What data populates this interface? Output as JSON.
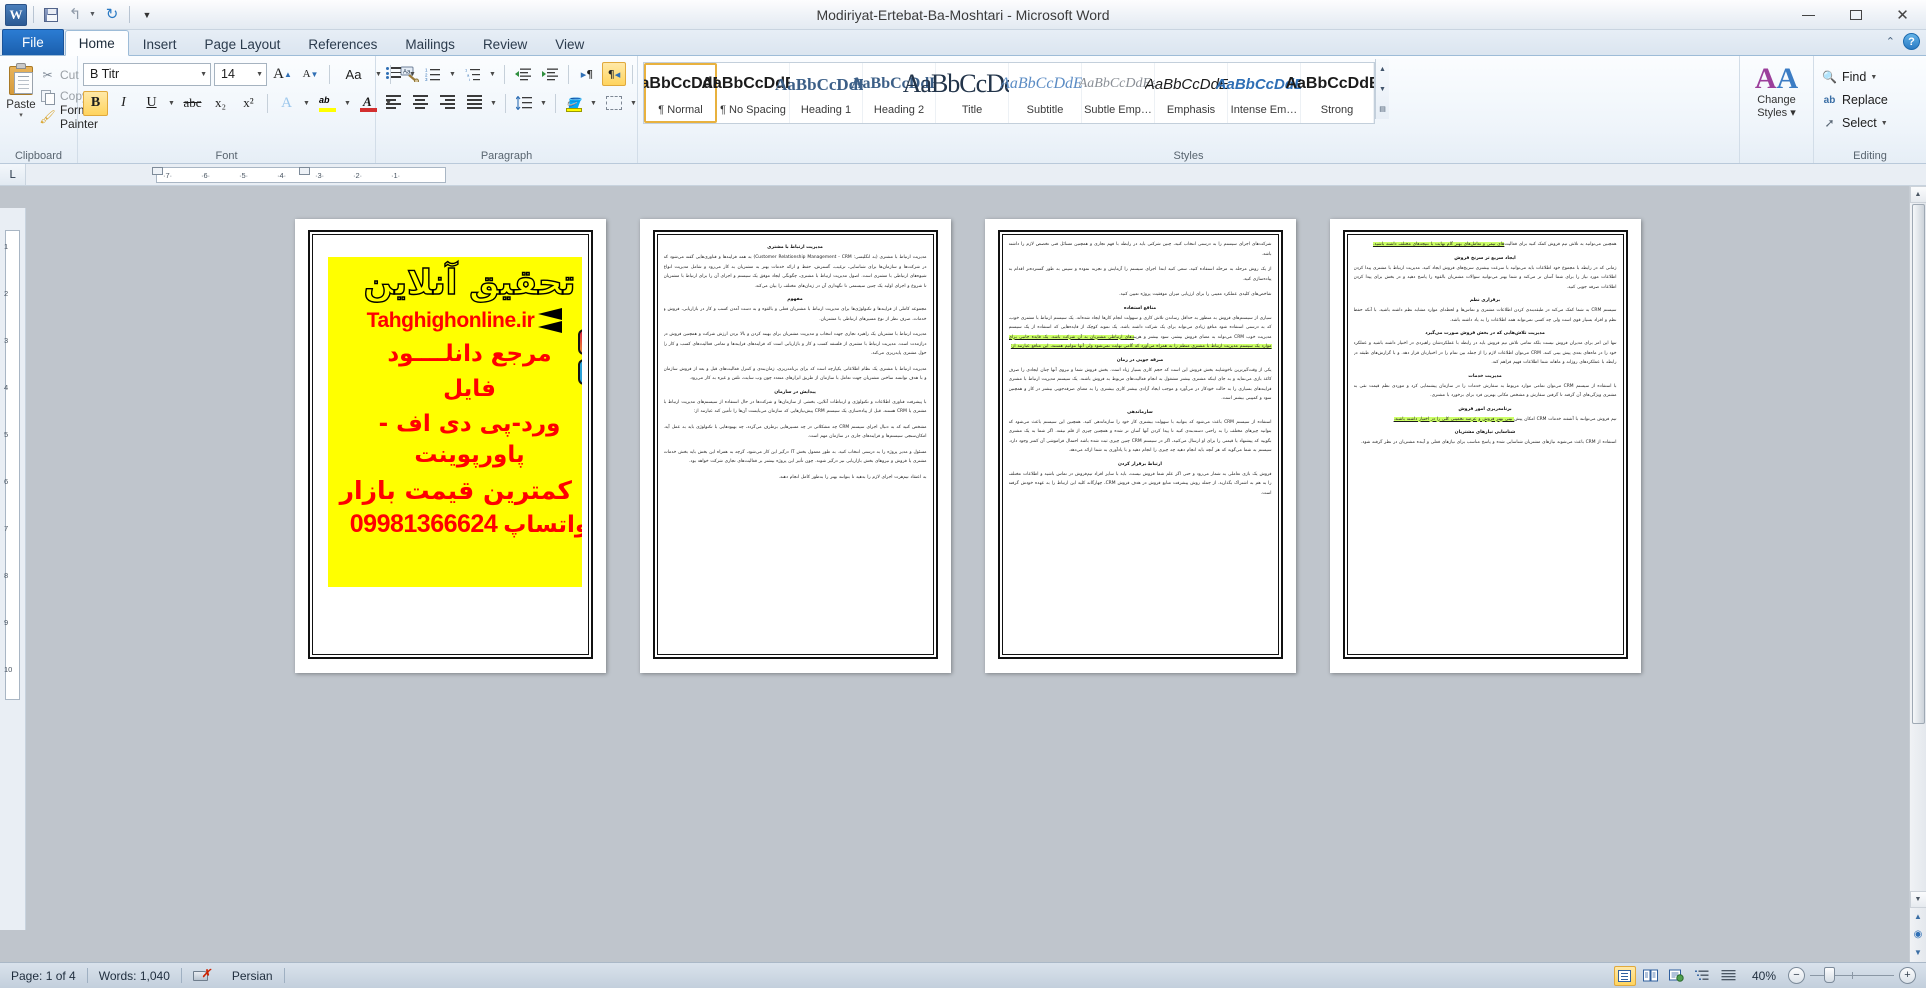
{
  "window": {
    "title": "Modiriyat-Ertebat-Ba-Moshtari  -  Microsoft Word",
    "minimize": "—",
    "maximize": "□",
    "close": "✕"
  },
  "qat": {
    "app_icon": "word-logo",
    "save": "save-icon",
    "undo": "↰",
    "undo_caret": "▾",
    "redo": "↻",
    "customize": "▾"
  },
  "tabs": [
    {
      "label": "File",
      "active": false,
      "file": true
    },
    {
      "label": "Home",
      "active": true,
      "file": false
    },
    {
      "label": "Insert",
      "active": false,
      "file": false
    },
    {
      "label": "Page Layout",
      "active": false,
      "file": false
    },
    {
      "label": "References",
      "active": false,
      "file": false
    },
    {
      "label": "Mailings",
      "active": false,
      "file": false
    },
    {
      "label": "Review",
      "active": false,
      "file": false
    },
    {
      "label": "View",
      "active": false,
      "file": false
    }
  ],
  "tabstrip_right": {
    "minimize_ribbon": "⌃",
    "help": "?"
  },
  "ribbon": {
    "clipboard": {
      "group_label": "Clipboard",
      "paste": "Paste",
      "paste_caret": "▾",
      "cut": "Cut",
      "copy": "Copy",
      "format_painter": "Format Painter",
      "launcher": "◢"
    },
    "font": {
      "group_label": "Font",
      "font_name": "B Titr",
      "font_size": "14",
      "grow_font": "A",
      "shrink_font": "A",
      "change_case": "Aa",
      "clear_formatting": "Ab",
      "bold": "B",
      "italic": "I",
      "underline": "U",
      "strikethrough": "abc",
      "subscript": "x₂",
      "superscript": "x²",
      "text_effects": "A",
      "highlight": "ab",
      "font_color": "A",
      "caret": "▾",
      "launcher": "◢"
    },
    "paragraph": {
      "group_label": "Paragraph",
      "bullets": "bullets-icon",
      "numbering": "numbering-icon",
      "multilevel": "multilevel-list-icon",
      "decrease_indent": "decrease-indent-icon",
      "increase_indent": "increase-indent-icon",
      "ltr": "▸¶",
      "rtl": "¶◂",
      "sort": "A\\nZ↓",
      "show_marks": "¶",
      "align_left": "align-left-icon",
      "align_center": "align-center-icon",
      "align_right": "align-right-icon",
      "justify": "justify-icon",
      "line_spacing": "line-spacing-icon",
      "shading": "shading-icon",
      "borders": "borders-icon",
      "caret": "▾",
      "launcher": "◢"
    },
    "styles": {
      "group_label": "Styles",
      "items": [
        {
          "sample": "AaBbCcDdEe",
          "name": "¶ Normal",
          "cls": "sty-normal",
          "selected": true
        },
        {
          "sample": "AaBbCcDdEe",
          "name": "¶ No Spacing",
          "cls": "sty-nospace",
          "selected": false
        },
        {
          "sample": "AaBbCcDdEe",
          "name": "Heading 1",
          "cls": "sty-h1",
          "selected": false
        },
        {
          "sample": "AaBbCcDdEe",
          "name": "Heading 2",
          "cls": "sty-h2",
          "selected": false
        },
        {
          "sample": "AaBbCcDdEe",
          "name": "Title",
          "cls": "sty-title",
          "selected": false
        },
        {
          "sample": "AaBbCcDdEe",
          "name": "Subtitle",
          "cls": "sty-sub",
          "selected": false
        },
        {
          "sample": "AaBbCcDdEe",
          "name": "Subtle Emp…",
          "cls": "sty-subem",
          "selected": false
        },
        {
          "sample": "AaBbCcDdEe",
          "name": "Emphasis",
          "cls": "sty-em",
          "selected": false
        },
        {
          "sample": "AaBbCcDdEe",
          "name": "Intense Em…",
          "cls": "sty-intense",
          "selected": false
        },
        {
          "sample": "AaBbCcDdEe",
          "name": "Strong",
          "cls": "sty-strong",
          "selected": false
        }
      ],
      "scroll_up": "▲",
      "scroll_down": "▼",
      "more": "▤"
    },
    "change_styles": {
      "label_line1": "Change",
      "label_line2": "Styles",
      "caret": "▾"
    },
    "editing": {
      "group_label": "Editing",
      "find": "Find",
      "replace": "Replace",
      "select": "Select",
      "caret": "▾"
    }
  },
  "ruler": {
    "tab_selector": "L",
    "h_ticks": [
      "7",
      "6",
      "5",
      "4",
      "3",
      "2",
      "1"
    ],
    "v_ticks": [
      "1",
      "2",
      "3",
      "4",
      "5",
      "6",
      "7",
      "8",
      "9",
      "10"
    ]
  },
  "document": {
    "ad": {
      "line1": "تحقیق آنلاین",
      "url": "Tahghighonline.ir",
      "line2": "مرجع دانلــــود",
      "line3": "فایل",
      "line4": "ورد-پی دی اف - پاورپوینت",
      "line5": "با کمترین قیمت بازار",
      "phone": "09981366624",
      "whatsapp": "واتساپ",
      "badge_instagram": "instagram-icon",
      "badge_telegram": "telegram-icon"
    },
    "pages": [
      {
        "n": 1,
        "type": "image",
        "sections": []
      },
      {
        "n": 2,
        "type": "text",
        "sections": [
          {
            "heading": "مدیریت ارتباط با مشتری",
            "align": "center",
            "paras": [
              "مدیریت ارتباط با مشتری (به انگلیسی: Customer Relationship Management - CRM) به همه فرایندها و فناوری‌هایی گفته می‌شود که در شرکت‌ها و سازمان‌ها برای شناسایی، ترغیب، گسترش، حفظ و ارائه خدمات بهتر به مشتریان به کار می‌رود و شامل مدیریت انواع شیوه‌های ارتباطی با مشتری است. اصول مدیریت ارتباط با مشتری، چگونگی ایجاد موفق یک سیستم و اجرای آن را برای ارتباط با مشتریان تا شروع و اجرای اولیه یک چنین سیستمی تا نگهداری آن در زمان‌های مختلف را بیان می‌کند."
            ]
          },
          {
            "heading": "مفهوم",
            "align": "center",
            "paras": [
              "مجموعه کاملی از فرایندها و تکنولوژی‌ها برای مدیریت ارتباط با مشتریان فعلی و بالقوه و به دست آمدن کسب و کار در بازاریابی، فروش و خدمات، صرف نظر از نوع مسیرهای ارتباطی با مشتریان.",
              "مدیریت ارتباط با مشتریان یک راهبرد تجاری جهت انتخاب و مدیریت مشتریان برای بهینه کردن و بالا بردن ارزش شرکت و همچنین فروش در درازمدت است. مدیریت ارتباط با مشتری از فلسفه کسب و کار و بازاریابی است که فرایندهای فرایندها و تمامی فعالیت‌های کسب و کار را حول مشتری پایه‌ریزی می‌کند.",
              "مدیریت ارتباط با مشتری یک نظام اطلاعاتی یکپارچه است که برای برنامه‌ریزی، زمان‌بندی و کنترل فعالیت‌های قبل و بعد از فروش سازمان و با هدف توانمند ساختن مشتریان جهت تعامل با سازمان از طریق ابزارهای متعدد چون وب سایت، تلفن و غیره به کار می‌رود."
            ]
          },
          {
            "heading": "پیدایش در سازمان",
            "align": "center",
            "paras": [
              "با پیشرفت فناوری اطلاعات و تکنولوژی و ارتباطات آنلاین، بخشی از سازمان‌ها و شرکت‌ها در حال استفاده از سیستم‌های مدیریت ارتباط با مشتری یا CRM هستند. قبل از پیاده‌سازی یک سیستم CRM پیش‌نیازهایی که سازمان می‌بایست آن‌ها را تأمین کند عبارتند از:",
              "مشخص کنید که به دنبال اجرای سیستم CRM چه مشکلاتی در چه مسیرهایی برطرف می‌گردد، چه بهبودهایی با تکنولوژی باید به عمل آید. امکان‌سنجی سیستم‌ها و فرایندهای جاری در سازمان مهم است.",
              "مسئول و مدیر پروژه را به درستی انتخاب کنید. به طور معمول بخش IT درگیر این کار می‌شود، گرچه به همراه این بخش باید بخش خدمات مشتری یا فروش و نیروهای بخش بازاریابی نیز درگیر شوند. چون تأثیر این پروژه بیشتر بر فعالیت‌های تجاری شرکت خواهد بود.",
              "به اعتقاد تیم‌هرت اجرای لازم را بدهید تا بتوانند بهتر را به‌طور کامل انجام دهند."
            ]
          }
        ]
      },
      {
        "n": 3,
        "type": "text",
        "sections": [
          {
            "heading": "",
            "align": "right",
            "paras": [
              "شرکت‌های اجرای سیستم را به درستی انتخاب کنید، چنین شرکتی باید در رابطه با فهم تجاری و همچنین مسائل فنی تخصص لازم را داشته باشد.",
              "از یک روش مرحله به مرحله استفاده کنید، سعی کنید ابتدا اجرای سیستم را آزمایش و تجربه نموده و سپس به طور گسترده‌تر اقدام به پیاده‌سازی کنید.",
              "شاخص‌های کلیدی عملکرد معینی را برای ارزیابی میزان موفقیت پروژه تعیین کنید."
            ]
          },
          {
            "heading": "منافع استفاده",
            "align": "center",
            "paras": [
              "سیاری از سیستم‌های فروش به منظور به حداقل رساندن تلاش کاری و سهولت انجام کارها ایجاد شده‌اند. یک سیستم ارتباط با مشتری خوب، که به درستی استفاده شود منافع زیادی می‌تواند برای یک شرکت داشته باشد. یک نمونه کوچک از فایده‌هایی که استفاده از یک سیستم مدیریت خوب CRM می‌تواند به معنای فروش بیشتر، سود بیشتر و هزینه‌های ارتباطی مشتریان به آن شرکت باشد. یک فایده جانبی برای موارد یک سیستم مدیریت ارتباط با مشتری منظم را به همراه می‌آورد که گامی نهایت نمی‌شود ولی آنها نتوانیم هستند، این منافع عبارتند از:"
            ]
          },
          {
            "heading": "صرفه جویی در زمان",
            "align": "center",
            "paras": [
              "یکی از وقت‌گیرترین ناخوشایند بخش فروش این است که حجم کاری بسیار زیاد است. بخش فروش شما و نیروی آنها چنان ایجادی را صرف کاغذ بازی می‌نماید و به جای اینکه مشتری بیشتر مشغول به انجام فعالیت‌های مربوط به فروش باشند. یک سیستم مدیریت ارتباط با مشتری فرایندهای بسیاری را به حالت خودکار در می‌آورد و موجب ایجاد آزادی بیشتر کاری بیشتری را به معنای صرفه‌جویی بیشتر در کار و همچنین سود و کمپینی بیشتر است."
            ]
          },
          {
            "heading": "سازماندهی",
            "align": "center",
            "paras": [
              "استفاده از سیستم CRM باعث می‌شود که بتوانید با سهولت بیشتری کار خود را سازماندهی کنید. همچنین این سیستم باعث می‌شود که بتوانید چیزهای مختلف را به راحتی دسته‌بندی کنید تا پیدا کردن آنها آسان تر شده و همچنین چیزی از قلم نیفتد. اگر شما به یک مشتری بگویید که پیشنهاد یا قیمتی را برای او ارسال می‌کنید، اگر در سیستم CRM چنین چیزی ثبت شده باشد احتمال فراموشی آن کمتر وجود دارد. سیستم به شما می‌گوید که هر آنچه باید انجام دهید چه چیزی را انجام دهید و با یادآوری به شما ارائه می‌دهد."
            ]
          },
          {
            "heading": "ارتباط برقرار کردن",
            "align": "center",
            "paras": [
              "فروش یک بازی تعاملی به شمار می‌رود و حتی اگر علم شما فروش نیست، باید با سایر افراد تیم‌فروش در تماس باشید و اطلاعات مختلف را به هم به اشتراک بگذارید. از جمله روش پیشرفت منابع فروش در هدف فروش CRM، چهارگانه کلید این ارتباط را به عهده خودش گرفته است."
            ]
          }
        ]
      },
      {
        "n": 4,
        "type": "text",
        "sections": [
          {
            "heading": "",
            "align": "right",
            "paras": [
              "همچنین می‌توانید به تلاش تیم فروش کمک کنید برای فعالیت‌های تیمی و تعامل‌های بهتر گام نهایت با نتیجه‌های مختلف داشته باشید."
            ]
          },
          {
            "heading": "ایجاد سریع تر سرنخ فروش",
            "align": "center",
            "paras": [
              "زمانی که در رابطه با مجموع خود اطلاعات باید می‌توانید با سرعت بیشتری سرنخ‌های فروش ایجاد کنید. مدیریت ارتباط با مشتری پیدا کردن اطلاعات مورد نیاز را برای شما آسان تر می‌کند و شما بهتر می‌توانید سوالات مشتریان بالقوه را پاسخ دهید و در بخش برای پیدا کردن اطلاعات صرفه جویی کنید."
            ]
          },
          {
            "heading": "برقراری نظم",
            "align": "center",
            "paras": [
              "سیستم CRM به شما کمک می‌کند در طبقه‌بندی کردن اطلاعات مشتری و تماس‌ها و لحظه‌ای موارد مشابه نظم داشته باشید. با آنکه حفظ نظم و افراد بسیار قوی است ولی چه کسی نمی‌تواند همه اطلاعات را به یاد داشته باشد."
            ]
          },
          {
            "heading": "مدیریت تلاش‌هایی که در بخش فروش صورت می‌گیرد",
            "align": "center",
            "paras": [
              "تنها این امر برای مدیران فروش نیست بلکه تمامی تلاش تیم فروش باید در رابطه با عملکردشان راهبردی در اختیار داشته باشید و عملکرد خود را در ماه‌های بعدی پیش بینی کنند. CRM می‌توان اطلاعات لازم را از جمله بین تمام را در اختیارتان قرار دهد. و با گزارش‌های طبقه در رابطه با عملکردهای روزانه و ماهانه شما اطلاعات فهیم فراهم کند."
            ]
          },
          {
            "heading": "مدیریت خدمات",
            "align": "center",
            "paras": [
              "با استفاده از سیستم CRM می‌توان تمامی موارد مربوط به سفارش خدمات را در سازمان پیشنمایی کرد و موردی نظم قیمت نقی به مشتری ویژگی‌های آن گرفته تا گرفتن سفارش و مشخص مکانی بهترین فرد برای برخورد با مشتری."
            ]
          },
          {
            "heading": "برنامه‌ریزی امور فروش",
            "align": "center",
            "paras": [
              "تیم فروش می‌توانند با آشفته خدمات CRM امکان پیش بینی بهتر فروش و عرضه تخمینی کلی را در اختیار داشته باشند."
            ]
          },
          {
            "heading": "شناسایی نیازهای مشتریان",
            "align": "center",
            "paras": [
              "استفاده از CRM باعث می‌شوند نیازهای مشتریان شناسایی شده و پاسخ مناسب برای نیازهای فعلی و آینده مشتریان در نظر گرفته شود."
            ]
          }
        ]
      }
    ]
  },
  "statusbar": {
    "page": "Page: 1 of 4",
    "words": "Words: 1,040",
    "spell_icon": "spelling-errors-icon",
    "language": "Persian",
    "views": [
      {
        "name": "print-layout",
        "glyph": "▤",
        "active": true
      },
      {
        "name": "full-screen-reading",
        "glyph": "▥",
        "active": false
      },
      {
        "name": "web-layout",
        "glyph": "▣",
        "active": false
      },
      {
        "name": "outline",
        "glyph": "▤",
        "active": false
      },
      {
        "name": "draft",
        "glyph": "▦",
        "active": false
      }
    ],
    "zoom": "40%",
    "zoom_out": "−",
    "zoom_in": "+"
  }
}
